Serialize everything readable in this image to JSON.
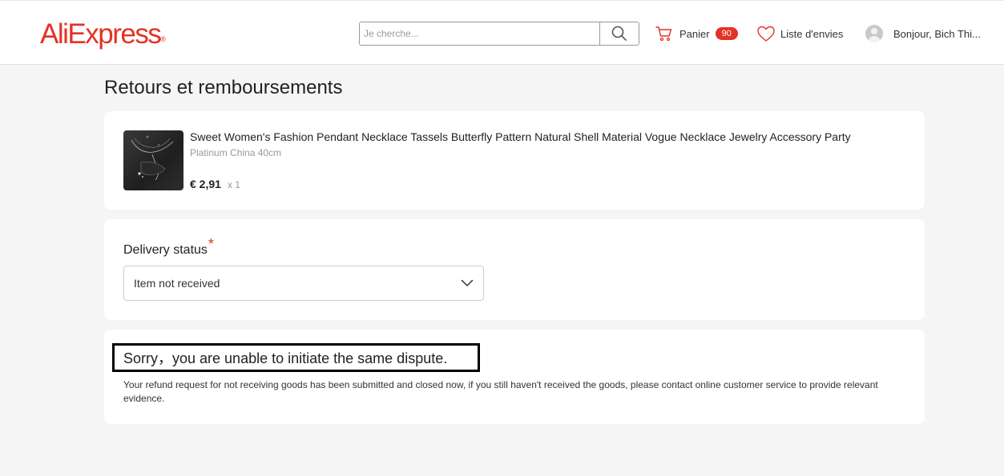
{
  "header": {
    "logo": "AliExpress",
    "logo_mark": "®",
    "search": {
      "placeholder": "Je cherche..."
    },
    "cart": {
      "label": "Panier",
      "count": "90"
    },
    "wishlist": {
      "label": "Liste d'envies"
    },
    "account": {
      "greeting": "Bonjour, Bich Thi..."
    }
  },
  "page": {
    "title": "Retours et remboursements"
  },
  "product": {
    "title": "Sweet Women's Fashion Pendant Necklace Tassels Butterfly Pattern Natural Shell Material Vogue Necklace Jewelry Accessory Party",
    "variant": "Platinum China 40cm",
    "price": "€ 2,91",
    "quantity": "x 1"
  },
  "delivery": {
    "label": "Delivery status",
    "required_mark": "*",
    "selected": "Item not received"
  },
  "notice": {
    "title": "Sorry，you are unable to initiate the same dispute.",
    "text": "Your refund request for not receiving goods has been submitted and closed now, if you still haven't received the goods, please contact online customer service to provide relevant evidence."
  },
  "colors": {
    "brand": "#e43225",
    "background": "#f5f5f5"
  }
}
